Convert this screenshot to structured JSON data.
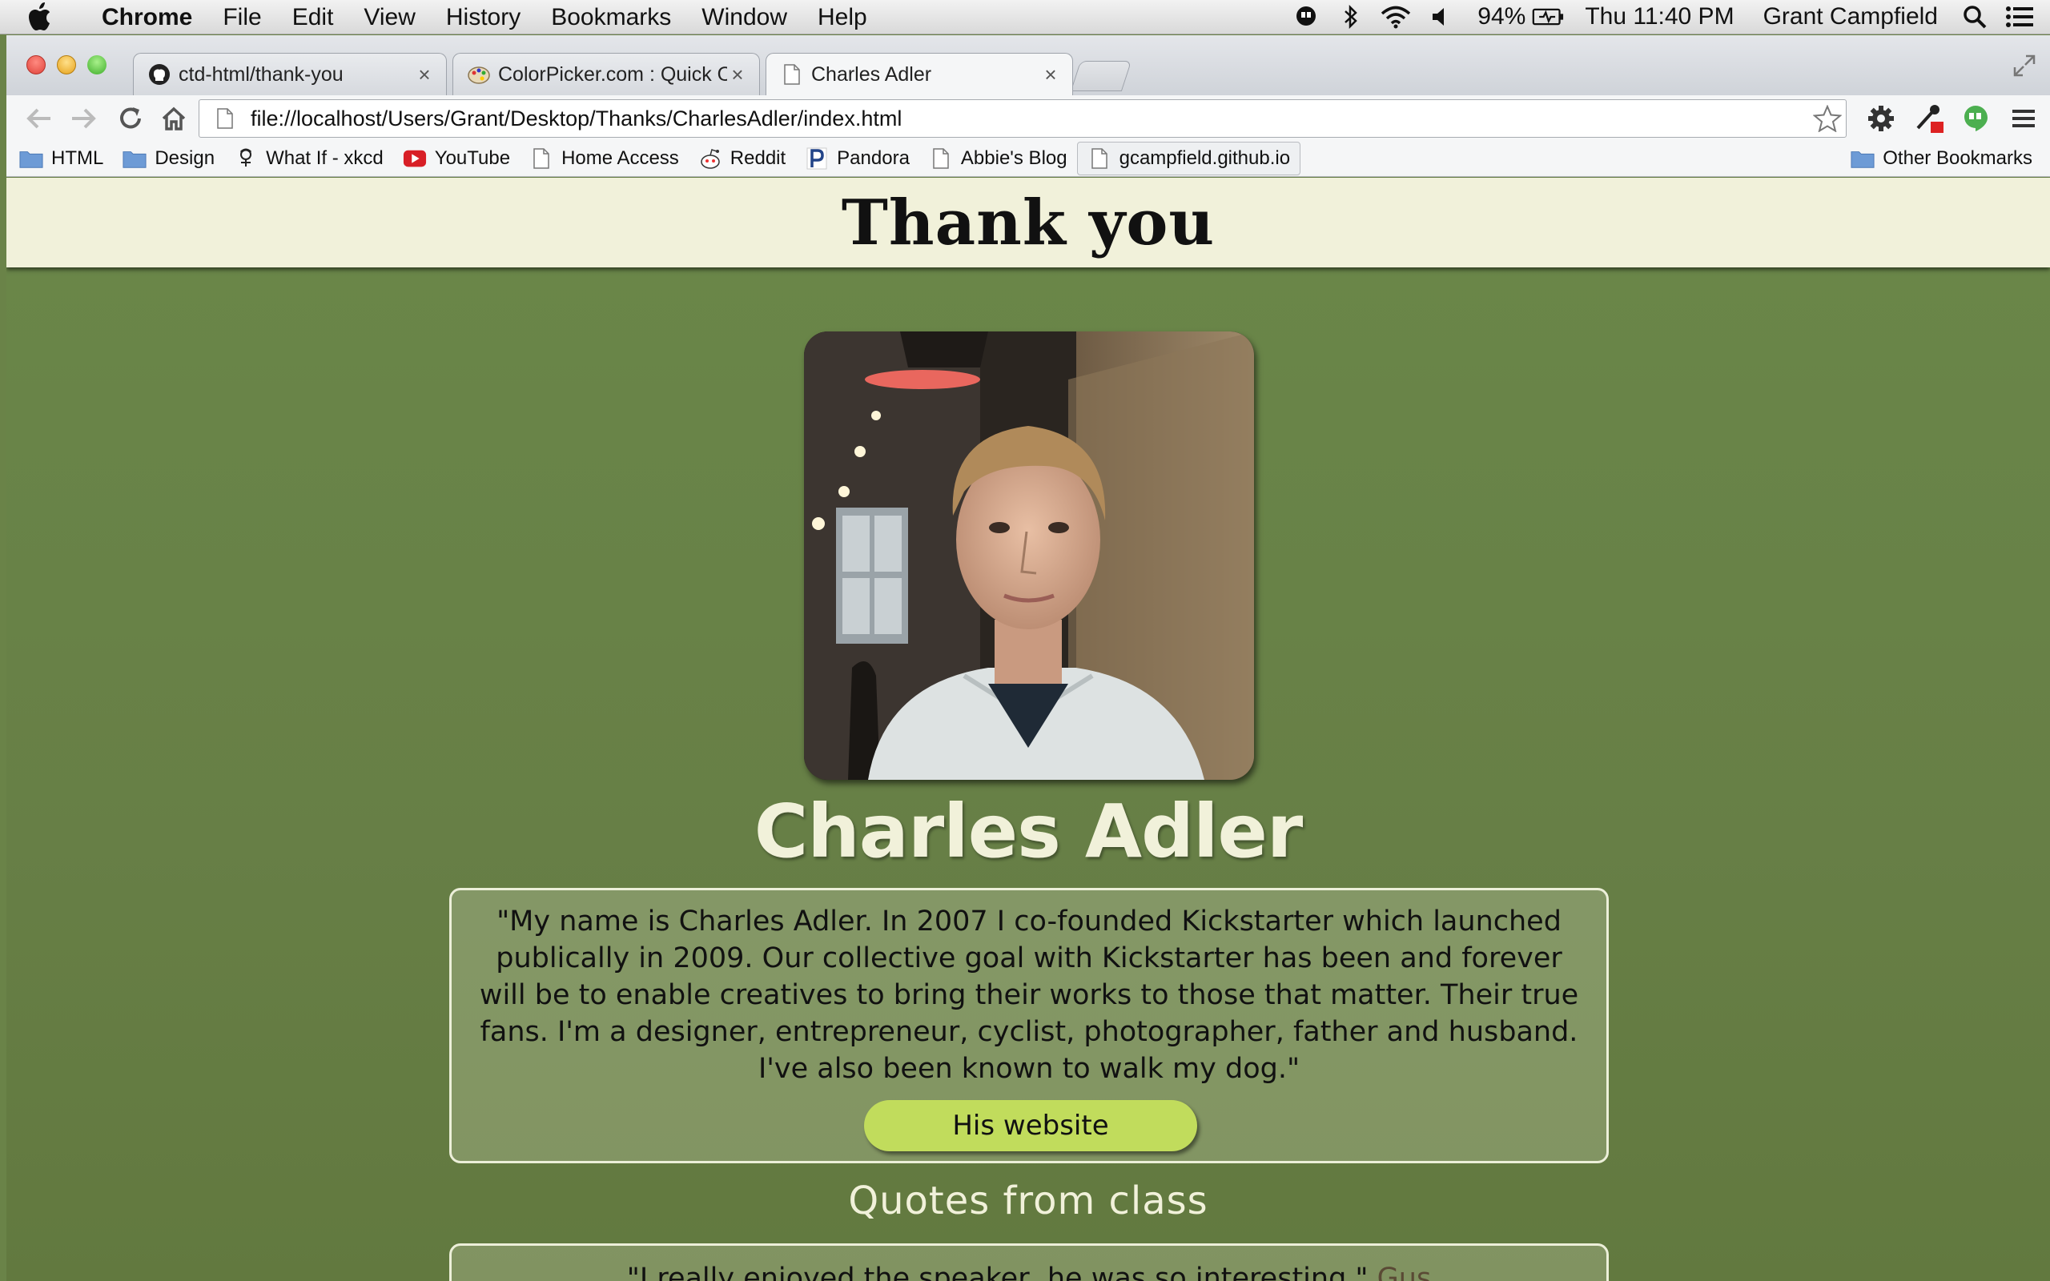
{
  "menubar": {
    "app_name": "Chrome",
    "items": [
      "File",
      "Edit",
      "View",
      "History",
      "Bookmarks",
      "Window",
      "Help"
    ],
    "battery": "94%",
    "clock": "Thu 11:40 PM",
    "user": "Grant Campfield"
  },
  "tabs": [
    {
      "title": "ctd-html/thank-you",
      "close": "×",
      "icon": "github-icon"
    },
    {
      "title": "ColorPicker.com : Quick O",
      "close": "×",
      "icon": "palette-icon"
    },
    {
      "title": "Charles Adler",
      "close": "×",
      "icon": "page-icon",
      "active": true
    }
  ],
  "address_bar": {
    "url": "file://localhost/Users/Grant/Desktop/Thanks/CharlesAdler/index.html"
  },
  "bookmarks": [
    {
      "label": "HTML",
      "icon": "folder-icon"
    },
    {
      "label": "Design",
      "icon": "folder-icon"
    },
    {
      "label": "What If - xkcd",
      "icon": "xkcd-icon"
    },
    {
      "label": "YouTube",
      "icon": "youtube-icon"
    },
    {
      "label": "Home Access",
      "icon": "page-icon"
    },
    {
      "label": "Reddit",
      "icon": "reddit-icon"
    },
    {
      "label": "Pandora",
      "icon": "pandora-icon"
    },
    {
      "label": "Abbie's Blog",
      "icon": "page-icon"
    },
    {
      "label": "gcampfield.github.io",
      "icon": "page-icon"
    }
  ],
  "other_bookmarks": "Other Bookmarks",
  "page": {
    "heading": "Thank you",
    "name": "Charles Adler",
    "bio": "\"My name is Charles Adler. In 2007 I co-founded Kickstarter which launched publically in 2009. Our collective goal with Kickstarter has been and forever will be to enable creatives to bring their works to those that matter. Their true fans. I'm a designer, entrepreneur, cyclist, photographer, father and husband. I've also been known to walk my dog.\"",
    "website_button": "His website",
    "quotes_heading": "Quotes from class",
    "quotes": [
      {
        "text": "\"I really enjoyed the speaker, he was so interesting.\"",
        "author": "Gus"
      }
    ]
  },
  "colors": {
    "page_background": "#6a8348",
    "header_background": "#f1f1da",
    "button_green": "#c1dc5c",
    "name_text": "#f1f1da"
  }
}
